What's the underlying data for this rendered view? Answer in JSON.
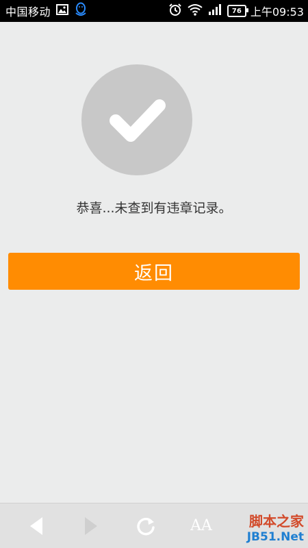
{
  "status_bar": {
    "carrier": "中国移动",
    "battery": "76",
    "time": "上午09:53"
  },
  "main": {
    "message": "恭喜...未查到有违章记录。",
    "back_button_label": "返回"
  },
  "toolbar": {
    "font_size_label": "AA"
  },
  "watermark": {
    "top": "脚本之家",
    "bottom": "JB51.Net"
  },
  "colors": {
    "accent": "#ff8c02",
    "background": "#ebecec",
    "check_circle": "#c8c8c8"
  },
  "icons": [
    "image-icon",
    "qq-icon",
    "alarm-icon",
    "wifi-icon",
    "signal-icon",
    "battery-icon",
    "check-icon",
    "back-arrow-icon",
    "forward-arrow-icon",
    "refresh-icon"
  ]
}
